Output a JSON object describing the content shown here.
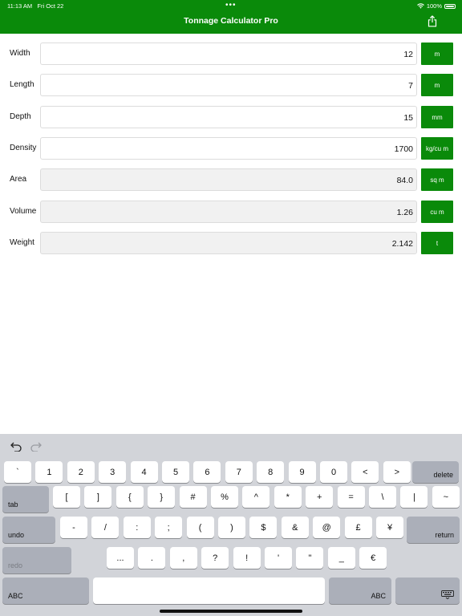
{
  "status": {
    "time": "11:13 AM",
    "date": "Fri Oct 22",
    "dots": "•••",
    "battery": "100%"
  },
  "header": {
    "title": "Tonnage Calculator Pro"
  },
  "rows": [
    {
      "label": "Width",
      "value": "12",
      "unit": "m"
    },
    {
      "label": "Length",
      "value": "7",
      "unit": "m"
    },
    {
      "label": "Depth",
      "value": "15",
      "unit": "mm"
    },
    {
      "label": "Density",
      "value": "1700",
      "unit": "kg/cu m"
    },
    {
      "label": "Area",
      "value": "84.0",
      "unit": "sq m"
    },
    {
      "label": "Volume",
      "value": "1.26",
      "unit": "cu m"
    },
    {
      "label": "Weight",
      "value": "2.142",
      "unit": "t"
    }
  ],
  "keyboard": {
    "row1": [
      "`",
      "1",
      "2",
      "3",
      "4",
      "5",
      "6",
      "7",
      "8",
      "9",
      "0",
      "<",
      ">"
    ],
    "row1_end": "delete",
    "row2_start": "tab",
    "row2": [
      "[",
      "]",
      "{",
      "}",
      "#",
      "%",
      "^",
      "*",
      "+",
      "=",
      "\\",
      "|",
      "~"
    ],
    "row3_start": "undo",
    "row3": [
      "-",
      "/",
      ":",
      ";",
      "(",
      ")",
      "$",
      "&",
      "@",
      "£",
      "¥"
    ],
    "row3_end": "return",
    "row4_start": "redo",
    "row4": [
      "...",
      ".",
      ",",
      "?",
      "!",
      "'",
      "\"",
      "_",
      "€"
    ],
    "row5_left": "ABC",
    "row5_right": "ABC"
  }
}
